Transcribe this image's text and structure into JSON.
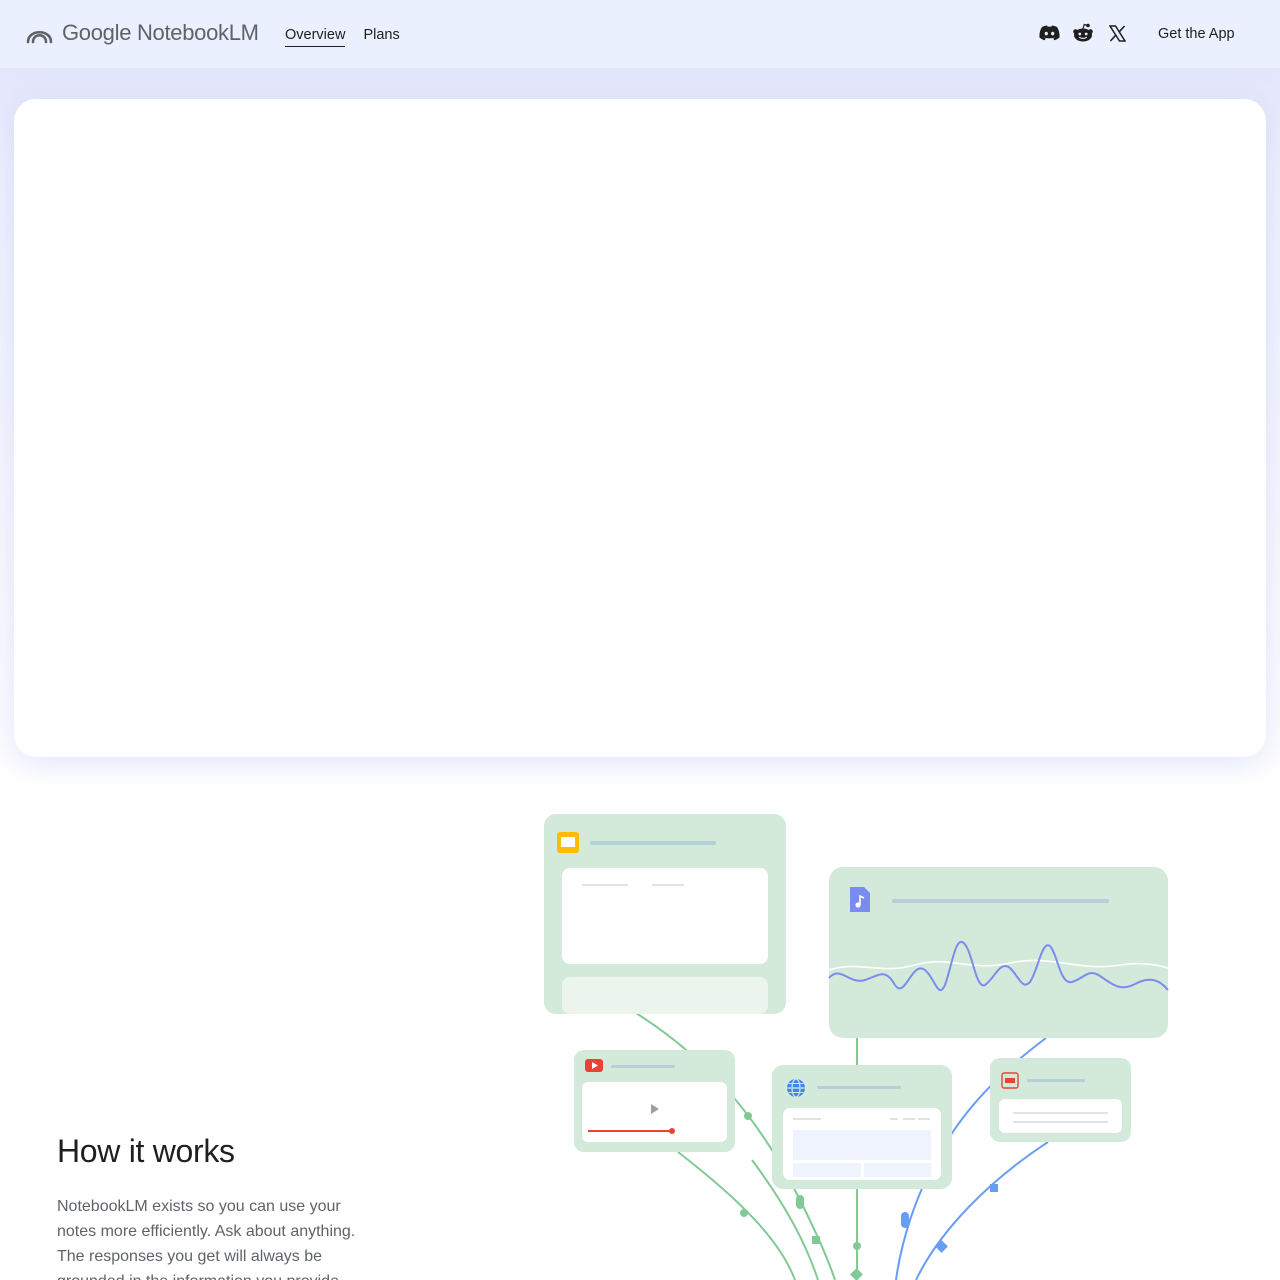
{
  "brand": {
    "google": "Google",
    "product": "NotebookLM",
    "logo_icon": "notebooklm-arcs-icon"
  },
  "nav": {
    "items": [
      {
        "label": "Overview",
        "active": true
      },
      {
        "label": "Plans",
        "active": false
      }
    ]
  },
  "socials": [
    {
      "icon": "discord-icon"
    },
    {
      "icon": "reddit-icon"
    },
    {
      "icon": "x-icon"
    }
  ],
  "cta": {
    "get_app": "Get the App"
  },
  "how_it_works": {
    "title": "How it works",
    "body": "NotebookLM exists so you can use your notes more efficiently. Ask about anything. The responses you get will always be grounded in the information you provide."
  },
  "colors": {
    "topbar_bg": "#eaf0fd",
    "card_green": "#d3e9d9",
    "line_green": "#81c995",
    "line_blue": "#669df6",
    "wave_purple": "#7b8cf0",
    "slides_yellow": "#fbbc04",
    "youtube_red": "#ea4335"
  },
  "illustration_icons": [
    "slides-icon",
    "audio-file-icon",
    "youtube-icon",
    "web-globe-icon",
    "pdf-icon"
  ]
}
